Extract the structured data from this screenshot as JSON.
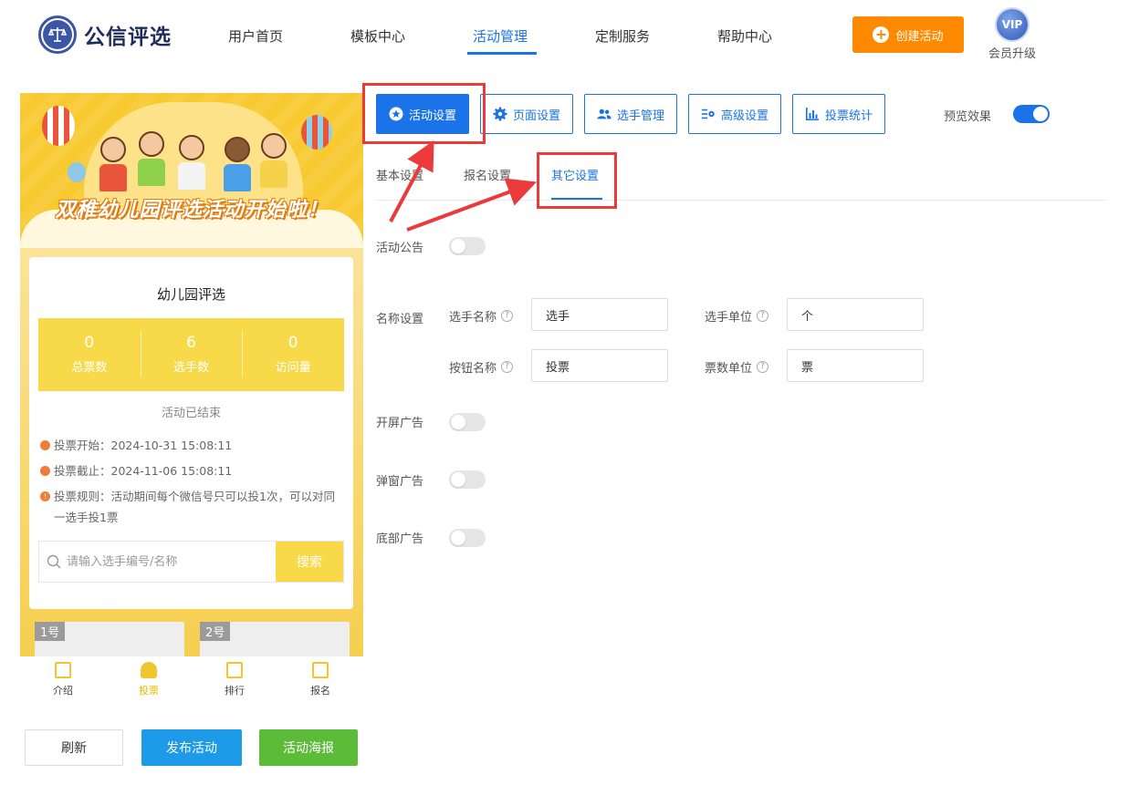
{
  "header": {
    "logo_text": "公信评选",
    "nav": [
      "用户首页",
      "模板中心",
      "活动管理",
      "定制服务",
      "帮助中心"
    ],
    "active_nav": "活动管理",
    "create_button": "创建活动",
    "vip_badge": "VIP",
    "vip_label": "会员升级"
  },
  "preview": {
    "banner_title": "双稚幼儿园评选活动开始啦！",
    "card_title": "幼儿园评选",
    "stats": [
      {
        "value": "0",
        "label": "总票数"
      },
      {
        "value": "6",
        "label": "选手数"
      },
      {
        "value": "0",
        "label": "访问量"
      }
    ],
    "status": "活动已结束",
    "vote_start": "投票开始：2024-10-31 15:08:11",
    "vote_end": "投票截止：2024-11-06 15:08:11",
    "vote_rule": "投票规则：活动期间每个微信号只可以投1次，可以对同一选手投1票",
    "search_placeholder": "请输入选手编号/名称",
    "search_button": "搜索",
    "thumbs": [
      "1号",
      "2号"
    ],
    "tabbar": [
      {
        "label": "介绍",
        "icon": "document-icon"
      },
      {
        "label": "投票",
        "icon": "person-icon"
      },
      {
        "label": "排行",
        "icon": "ranking-icon"
      },
      {
        "label": "报名",
        "icon": "signup-icon"
      }
    ],
    "active_tab": "投票"
  },
  "bottom_buttons": {
    "refresh": "刷新",
    "publish": "发布活动",
    "poster": "活动海报"
  },
  "toolbar": {
    "buttons": [
      "活动设置",
      "页面设置",
      "选手管理",
      "高级设置",
      "投票统计"
    ],
    "active": "活动设置",
    "preview_label": "预览效果",
    "preview_on": true
  },
  "subtabs": {
    "items": [
      "基本设置",
      "报名设置",
      "其它设置"
    ],
    "active": "其它设置"
  },
  "settings": {
    "notice_label": "活动公告",
    "notice_on": false,
    "name_section_label": "名称设置",
    "player_name_label": "选手名称",
    "player_name_value": "选手",
    "player_unit_label": "选手单位",
    "player_unit_value": "个",
    "button_name_label": "按钮名称",
    "button_name_value": "投票",
    "vote_unit_label": "票数单位",
    "vote_unit_value": "票",
    "splash_ad_label": "开屏广告",
    "splash_ad_on": false,
    "popup_ad_label": "弹窗广告",
    "popup_ad_on": false,
    "bottom_ad_label": "底部广告",
    "bottom_ad_on": false
  },
  "colors": {
    "primary": "#1a73e8",
    "orange": "#ff8a00",
    "green": "#5dbb3a",
    "yellow": "#f8d94a",
    "annotation_red": "#ea3a3a"
  }
}
